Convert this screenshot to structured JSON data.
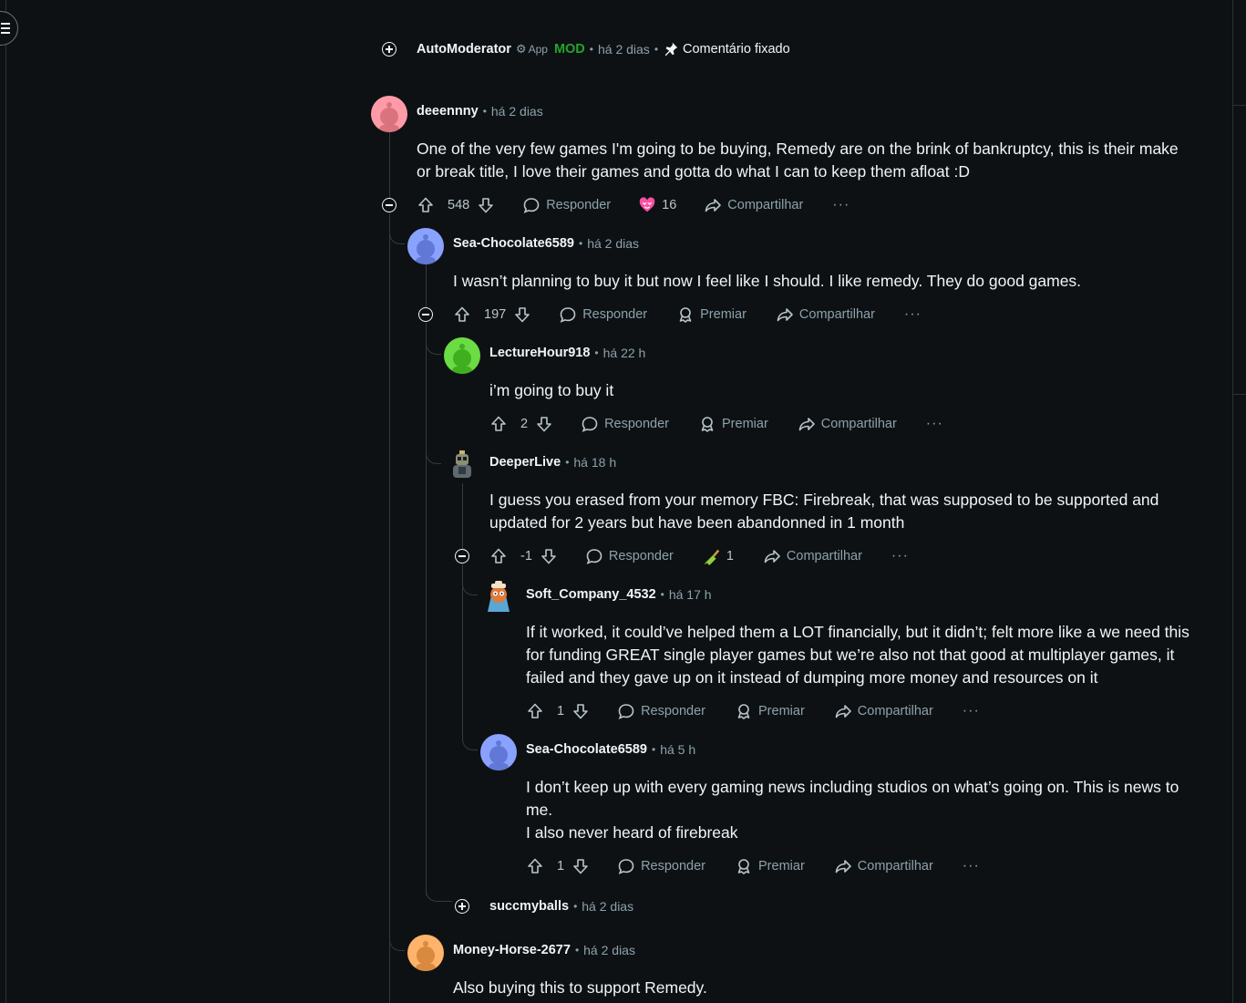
{
  "automod": {
    "author": "AutoModerator",
    "app_label": "App",
    "mod_label": "MOD",
    "time": "há 2 dias",
    "pinned_label": "Comentário fixado"
  },
  "labels": {
    "reply": "Responder",
    "award": "Premiar",
    "share": "Compartilhar",
    "more": "···"
  },
  "comments": [
    {
      "author": "deeennny",
      "time": "há 2 dias",
      "text": "One of the very few games I'm going to be buying, Remedy are on the brink of bankruptcy, this is their make or break title, I love their games and gotta do what I can to keep them afloat :D",
      "score": "548",
      "award_count": "16"
    },
    {
      "author": "Sea-Chocolate6589",
      "time": "há 2 dias",
      "text": "I wasn’t planning to buy it but now I feel like I should. I like remedy. They do good games.",
      "score": "197"
    },
    {
      "author": "LectureHour918",
      "time": "há 22 h",
      "text": "i’m going to buy it",
      "score": "2"
    },
    {
      "author": "DeeperLive",
      "time": "há 18 h",
      "text": "I guess you erased from your memory FBC: Firebreak, that was supposed to be supported and updated for 2 years but have been abandonned in 1 month",
      "score": "-1",
      "award_count": "1"
    },
    {
      "author": "Soft_Company_4532",
      "time": "há 17 h",
      "text": "If it worked, it could’ve helped them a LOT financially, but it didn’t; felt more like a we need this for funding GREAT single player games but we’re also not that good at multiplayer games, it failed and they gave up on it instead of dumping more money and resources on it",
      "score": "1"
    },
    {
      "author": "Sea-Chocolate6589",
      "time": "há 5 h",
      "text_line1": "I don’t keep up with every gaming news including studios on what’s going on. This is news to me.",
      "text_line2": "I also never heard of firebreak",
      "score": "1"
    },
    {
      "author": "succmyballs",
      "time": "há 2 dias"
    },
    {
      "author": "Money-Horse-2677",
      "time": "há 2 dias",
      "text": "Also buying this to support Remedy."
    }
  ],
  "colors": {
    "background": "#0e1113",
    "text": "#f2f4f5",
    "muted": "#8ba2ad",
    "mod_green": "#23a52b",
    "thread_line": "#33393d"
  }
}
